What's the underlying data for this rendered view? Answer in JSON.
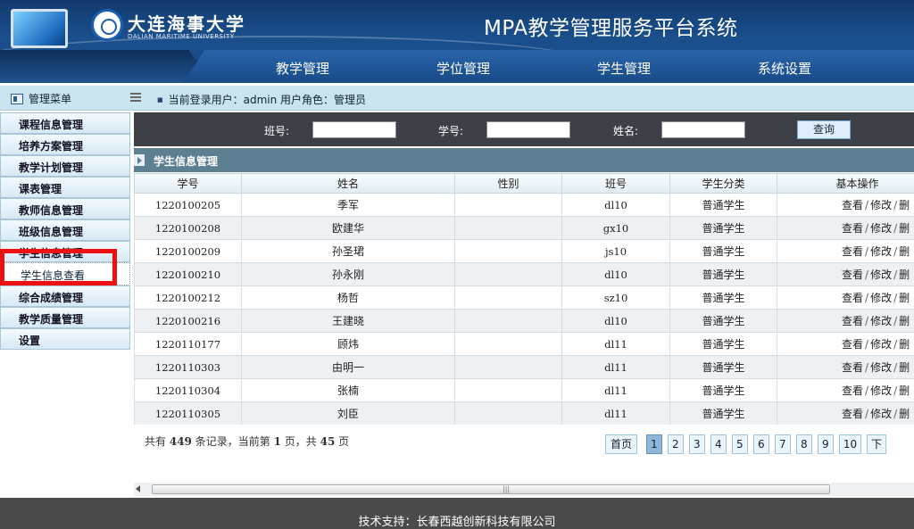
{
  "header": {
    "logo_cn": "大连海事大学",
    "logo_en": "DALIAN MARITIME UNIVERSITY",
    "system_title": "MPA教学管理服务平台系统"
  },
  "nav": [
    "教学管理",
    "学位管理",
    "学生管理",
    "系统设置"
  ],
  "subbar": {
    "menu_title": "管理菜单",
    "login_info": "当前登录用户：admin 用户角色：管理员"
  },
  "sidebar": {
    "items": [
      "课程信息管理",
      "培养方案管理",
      "教学计划管理",
      "课表管理",
      "教师信息管理",
      "班级信息管理",
      "学生信息管理"
    ],
    "active_sub": "学生信息查看",
    "items_after": [
      "综合成绩管理",
      "教学质量管理",
      "设置"
    ]
  },
  "search": {
    "class_label": "班号:",
    "id_label": "学号:",
    "name_label": "姓名:",
    "class_value": "",
    "id_value": "",
    "name_value": "",
    "button": "查询"
  },
  "section_title": "学生信息管理",
  "table": {
    "headers": [
      "学号",
      "姓名",
      "性别",
      "班号",
      "学生分类",
      "基本操作"
    ],
    "rows": [
      [
        "1220100205",
        "季军",
        "",
        "dl10",
        "普通学生"
      ],
      [
        "1220100208",
        "欧建华",
        "",
        "gx10",
        "普通学生"
      ],
      [
        "1220100209",
        "孙圣珺",
        "",
        "js10",
        "普通学生"
      ],
      [
        "1220100210",
        "孙永刚",
        "",
        "dl10",
        "普通学生"
      ],
      [
        "1220100212",
        "杨哲",
        "",
        "sz10",
        "普通学生"
      ],
      [
        "1220100216",
        "王建晓",
        "",
        "dl10",
        "普通学生"
      ],
      [
        "1220110177",
        "顾炜",
        "",
        "dl11",
        "普通学生"
      ],
      [
        "1220110303",
        "由明一",
        "",
        "dl11",
        "普通学生"
      ],
      [
        "1220110304",
        "张楠",
        "",
        "dl11",
        "普通学生"
      ],
      [
        "1220110305",
        "刘臣",
        "",
        "dl11",
        "普通学生"
      ]
    ],
    "ops": [
      "查看",
      "修改",
      "删"
    ]
  },
  "pagination": {
    "summary_prefix": "共有",
    "total": "449",
    "summary_mid1": "条记录，当前第",
    "current": "1",
    "summary_mid2": "页，共",
    "pages_total": "45",
    "summary_suffix": "页",
    "first_label": "首页",
    "pages": [
      "1",
      "2",
      "3",
      "4",
      "5",
      "6",
      "7",
      "8",
      "9",
      "10"
    ],
    "next_label": "下"
  },
  "footer": "技术支持：长春西越创新科技有限公司"
}
